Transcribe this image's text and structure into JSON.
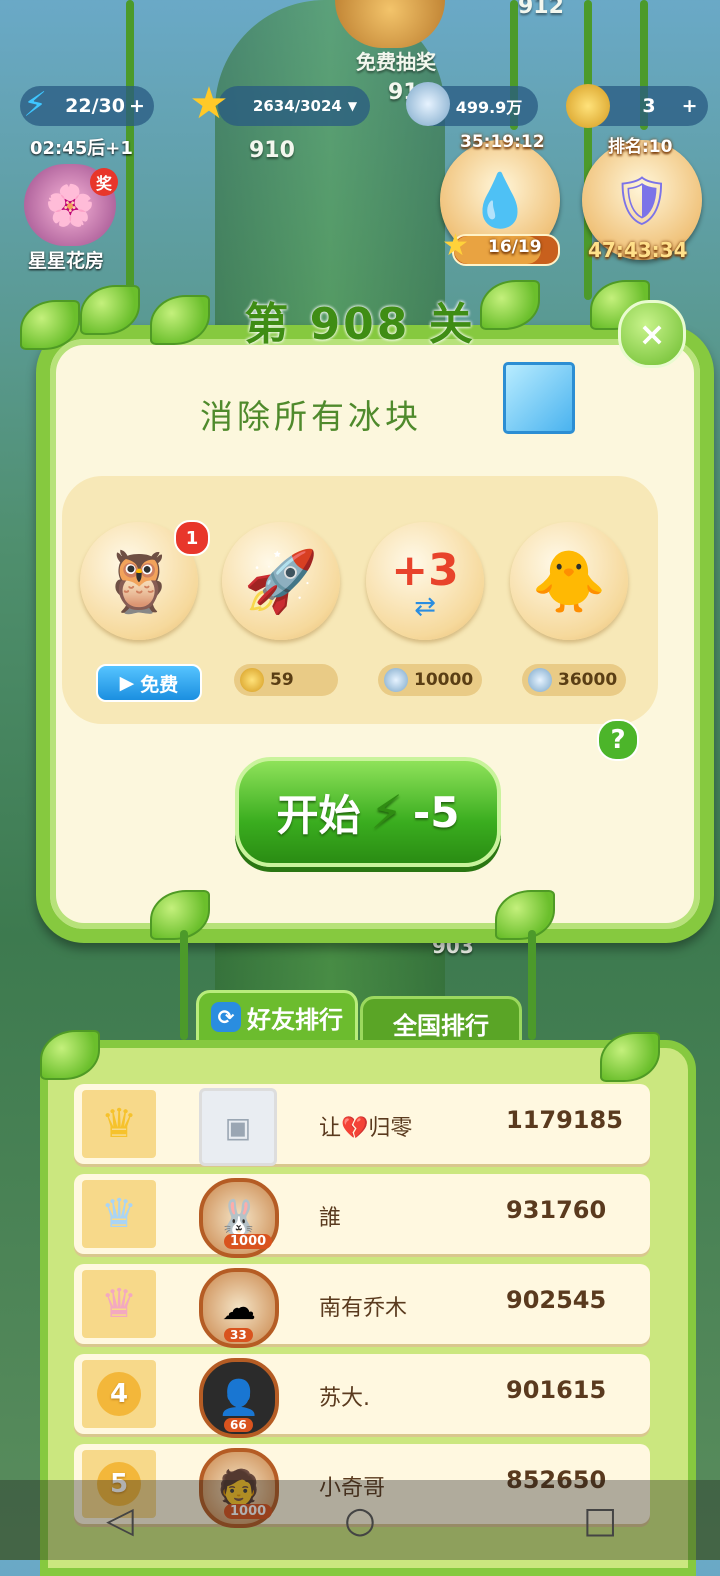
{
  "map": {
    "free_lottery": "免费抽奖",
    "level_912": "912",
    "level_910": "910",
    "level_903": "903",
    "level_9_partial": "91",
    "star_house": "星星花房",
    "star_house_badge": "奖"
  },
  "hud": {
    "energy": "22/30",
    "energy_timer": "02:45后+1",
    "stars": "2634/3024",
    "coins": "499.9万",
    "gold_partial": "3"
  },
  "timers": {
    "potion_timer": "35:19:12",
    "potion_progress": "16/19",
    "rank_label": "排名:10",
    "rank_timer": "47:43:34"
  },
  "panel": {
    "level_title": "第 908 关",
    "goal": "消除所有冰块",
    "close": "×",
    "help": "?",
    "boosters": [
      {
        "icon": "rainbow-bird-icon",
        "price_label": "免费",
        "badge": "1"
      },
      {
        "icon": "firework-rocket-icon",
        "price": "59"
      },
      {
        "icon": "plus-three-moves-icon",
        "glyph": "+3",
        "price": "10000"
      },
      {
        "icon": "pet-friends-icon",
        "price": "36000"
      }
    ],
    "start_label": "开始",
    "start_cost": "-5"
  },
  "ranking": {
    "tab_friends": "好友排行",
    "tab_national": "全国排行",
    "rows": [
      {
        "rank": "1",
        "name": "让💔归零",
        "score": "1179185",
        "avatar_badge": ""
      },
      {
        "rank": "2",
        "name": "誰",
        "score": "931760",
        "avatar_badge": "1000"
      },
      {
        "rank": "3",
        "name": "南有乔木",
        "score": "902545",
        "avatar_badge": "33"
      },
      {
        "rank": "4",
        "name": "苏大.",
        "score": "901615",
        "avatar_badge": "66"
      },
      {
        "rank": "5",
        "name": "小奇哥",
        "score": "852650",
        "avatar_badge": "1000"
      }
    ]
  },
  "colors": {
    "vine_green": "#86c93f",
    "panel_bg": "#fcf7dd",
    "title_green": "#3f8d14",
    "start_green": "#3aad1f"
  }
}
